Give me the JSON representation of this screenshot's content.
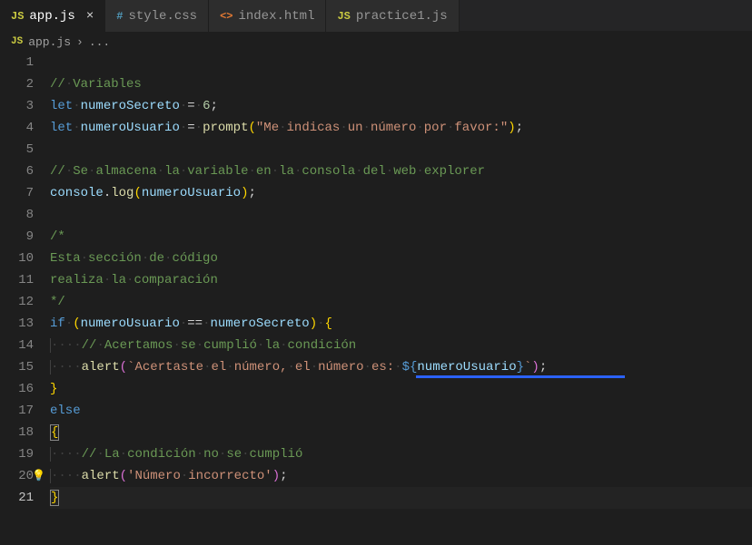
{
  "tabs": [
    {
      "icon": "JS",
      "iconClass": "js-i",
      "label": "app.js",
      "active": true,
      "closable": true
    },
    {
      "icon": "#",
      "iconClass": "css-i",
      "label": "style.css",
      "active": false
    },
    {
      "icon": "<>",
      "iconClass": "html-i",
      "label": "index.html",
      "active": false
    },
    {
      "icon": "JS",
      "iconClass": "js-i",
      "label": "practice1.js",
      "active": false
    }
  ],
  "breadcrumb": {
    "icon": "JS",
    "file": "app.js",
    "sep": "›",
    "more": "..."
  },
  "lineCount": 21,
  "currentLine": 21,
  "code": {
    "l2_comment": "// Variables",
    "l3_let": "let",
    "l3_var": "numeroSecreto",
    "l3_eq": " = ",
    "l3_val": "6",
    "l4_let": "let",
    "l4_var": "numeroUsuario",
    "l4_eq": " = ",
    "l4_fn": "prompt",
    "l4_str": "\"Me indicas un número por favor:\"",
    "l6_comment": "// Se almacena la variable en la consola del web explorer",
    "l7_obj": "console",
    "l7_dot": ".",
    "l7_fn": "log",
    "l7_arg": "numeroUsuario",
    "l9_open": "/*",
    "l10_text": "Esta sección de código",
    "l11_text": "realiza la comparación",
    "l12_close": "*/",
    "l13_if": "if",
    "l13_lhs": "numeroUsuario",
    "l13_op": " == ",
    "l13_rhs": "numeroSecreto",
    "l14_comment": "// Acertamos se cumplió la condición",
    "l15_fn": "alert",
    "l15_str_pre": "`Acertaste el número, el número es: ",
    "l15_tpl_open": "${",
    "l15_tpl_var": "numeroUsuario",
    "l15_tpl_close": "}",
    "l15_str_post": "`",
    "l17_else": "else",
    "l19_comment": "// La condición no se cumplió",
    "l20_fn": "alert",
    "l20_str": "'Número incorrecto'"
  }
}
